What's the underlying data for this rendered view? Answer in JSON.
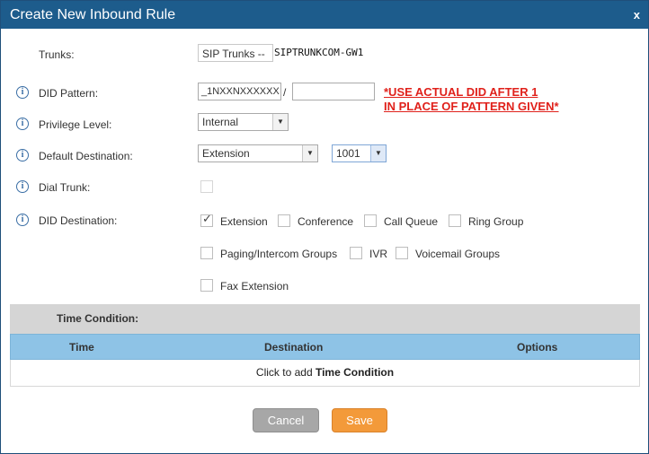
{
  "dialog": {
    "title": "Create New Inbound Rule",
    "close_label": "x"
  },
  "form": {
    "trunks": {
      "label": "Trunks:",
      "prefix": "SIP Trunks --",
      "name": "SIPTRUNKCOM-GW1"
    },
    "did_pattern": {
      "label": "DID Pattern:",
      "value": "_1NXXNXXXXXX",
      "separator": "/",
      "second_value": ""
    },
    "privilege_level": {
      "label": "Privilege Level:",
      "selected": "Internal"
    },
    "default_destination": {
      "label": "Default Destination:",
      "selected": "Extension",
      "extension": "1001"
    },
    "dial_trunk": {
      "label": "Dial Trunk:",
      "checked": false
    },
    "did_destination": {
      "label": "DID Destination:",
      "options": [
        {
          "label": "Extension",
          "checked": true
        },
        {
          "label": "Conference",
          "checked": false
        },
        {
          "label": "Call Queue",
          "checked": false
        },
        {
          "label": "Ring Group",
          "checked": false
        },
        {
          "label": "Paging/Intercom Groups",
          "checked": false
        },
        {
          "label": "IVR",
          "checked": false
        },
        {
          "label": "Voicemail Groups",
          "checked": false
        },
        {
          "label": "Fax Extension",
          "checked": false
        }
      ]
    }
  },
  "annotation": {
    "line1": "*USE ACTUAL DID AFTER 1",
    "line2": "IN PLACE OF PATTERN GIVEN*",
    "color": "#e0211b"
  },
  "time_condition": {
    "title": "Time Condition:",
    "columns": [
      "Time",
      "Destination",
      "Options"
    ],
    "add_prefix": "Click to add ",
    "add_bold": "Time Condition"
  },
  "buttons": {
    "cancel": "Cancel",
    "save": "Save"
  },
  "icons": {
    "info": "info-icon",
    "checkmark": "checkmark-icon",
    "dropdown": "chevron-down-icon"
  },
  "colors": {
    "titlebar": "#1d5c8c",
    "save": "#f39a3a",
    "cancel": "#a7a7a7",
    "table_header": "#8ec3e6"
  }
}
